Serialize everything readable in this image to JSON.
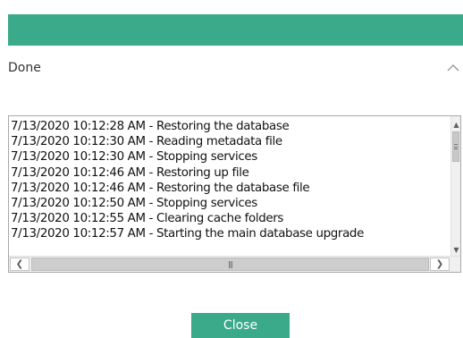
{
  "progress": {
    "value": 1.0,
    "color": "#3aaa8a"
  },
  "status": {
    "label": "Done",
    "collapse_icon": "chevron-up-icon"
  },
  "log": {
    "lines": [
      "7/13/2020 10:12:28 AM - Restoring the database",
      "7/13/2020 10:12:30 AM - Reading metadata file",
      "7/13/2020 10:12:30 AM - Stopping services",
      "7/13/2020 10:12:46 AM - Restoring up file",
      "7/13/2020 10:12:46 AM - Restoring the database file",
      "7/13/2020 10:12:50 AM - Stopping services",
      "7/13/2020 10:12:55 AM - Clearing cache folders",
      "7/13/2020 10:12:57 AM - Starting the main database upgrade"
    ],
    "scroll_up_icon": "arrow-up-icon",
    "scroll_down_icon": "arrow-down-icon",
    "scroll_left_icon": "arrow-left-icon",
    "scroll_right_icon": "arrow-right-icon"
  },
  "footer": {
    "close_label": "Close",
    "accent_color": "#3aaa8a"
  }
}
